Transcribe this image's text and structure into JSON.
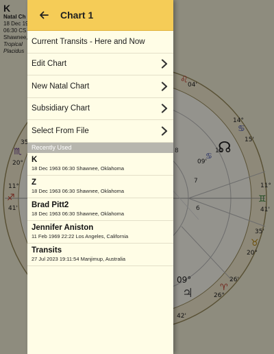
{
  "background": {
    "chart_name": "K",
    "subtitle": "Natal Ch",
    "date_line": "18 Dec 19",
    "time_line": "06:30 CS",
    "place_line": "Shawnee,",
    "zodiac": "Tropical",
    "house_system": "Placidus",
    "wheel_degrees": [
      "04'",
      "14°",
      "15'",
      "35'",
      "20°",
      "11°",
      "41'",
      "11°",
      "41'",
      "35'",
      "20°",
      "26'",
      "26°",
      "09'",
      "09°",
      "42'",
      "11",
      "8",
      "7",
      "6"
    ],
    "colors": {
      "wheel_ring": "#c9b87a",
      "leo_red": "#c0392b",
      "cancer_blue": "#3949ab",
      "gemini_green": "#2e7d32",
      "taurus_gold": "#b8860b",
      "node_black": "#222222"
    }
  },
  "drawer": {
    "title": "Chart 1",
    "back_icon": "arrow-left-icon",
    "menu": [
      {
        "label": "Current Transits - Here and Now",
        "has_chevron": false
      },
      {
        "label": "Edit Chart",
        "has_chevron": true
      },
      {
        "label": "New Natal Chart",
        "has_chevron": true
      },
      {
        "label": "Subsidiary Chart",
        "has_chevron": true
      },
      {
        "label": "Select From File",
        "has_chevron": true
      }
    ],
    "section_label": "Recently Used",
    "recent": [
      {
        "name": "K",
        "detail": "18 Dec 1963 06:30 Shawnee, Oklahoma"
      },
      {
        "name": "Z",
        "detail": "18 Dec 1963 06:30 Shawnee, Oklahoma"
      },
      {
        "name": "Brad Pitt2",
        "detail": "18 Dec 1963 06:30 Shawnee, Oklahoma"
      },
      {
        "name": "Jennifer Aniston",
        "detail": "11 Feb 1969 22:22 Los Angeles, California"
      },
      {
        "name": "Transits",
        "detail": "27 Jul 2023 19:11:54 Manjimup, Australia"
      }
    ],
    "colors": {
      "header": "#f5cc57",
      "body": "#fffde6",
      "section": "#b7b6ae"
    }
  }
}
